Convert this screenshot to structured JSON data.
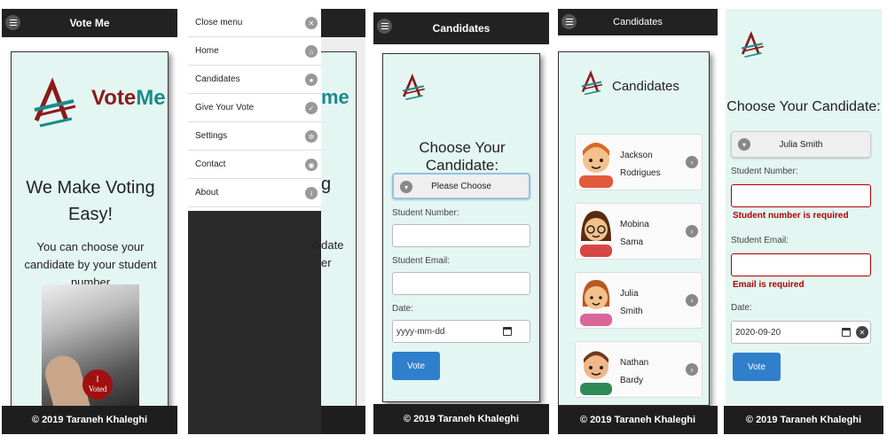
{
  "colors": {
    "header": "#222222",
    "card_bg": "#e3f6f2",
    "accent_blue": "#2f7fcc",
    "error_red": "#b30000",
    "brand_red": "#8b1a1a",
    "brand_teal": "#1a8a8a"
  },
  "footer_text": "© 2019 Taraneh Khaleghi",
  "screen1": {
    "header_title": "Vote Me",
    "logo_name_a": "Vote",
    "logo_name_b": "Me",
    "headline": "We Make Voting Easy!",
    "subtext": "You can choose your candidate by your student number",
    "photo_tag_line1": "I",
    "photo_tag_line2": "Voted"
  },
  "screen2": {
    "menu_items": [
      {
        "label": "Close menu",
        "icon": "close-icon"
      },
      {
        "label": "Home",
        "icon": "home-icon"
      },
      {
        "label": "Candidates",
        "icon": "user-icon"
      },
      {
        "label": "Give Your Vote",
        "icon": "check-icon"
      },
      {
        "label": "Settings",
        "icon": "gear-icon"
      },
      {
        "label": "Contact",
        "icon": "location-icon"
      },
      {
        "label": "About",
        "icon": "info-icon"
      }
    ],
    "peek_text_1": "me",
    "peek_text_2": "g",
    "peek_text_3": "didate",
    "peek_text_4": "er"
  },
  "screen3": {
    "header_title": "Candidates",
    "heading": "Choose Your Candidate:",
    "select_value": "Please Choose",
    "label_student_number": "Student Number:",
    "label_student_email": "Student Email:",
    "label_date": "Date:",
    "date_placeholder": "yyyy-mm-dd",
    "vote_label": "Vote"
  },
  "screen4": {
    "header_title": "Candidates",
    "heading": "Candidates",
    "candidates": [
      {
        "line1": "Jackson",
        "line2": "Rodrigues"
      },
      {
        "line1": "Mobina",
        "line2": "Sama"
      },
      {
        "line1": "Julia",
        "line2": "Smith"
      },
      {
        "line1": "Nathan",
        "line2": "Bardy"
      }
    ]
  },
  "screen5": {
    "heading": "Choose Your Candidate:",
    "select_value": "Julia Smith",
    "label_student_number": "Student Number:",
    "error_number": "Student number is required",
    "label_student_email": "Student Email:",
    "error_email": "Email is required",
    "label_date": "Date:",
    "date_value": "2020-09-20",
    "vote_label": "Vote"
  }
}
